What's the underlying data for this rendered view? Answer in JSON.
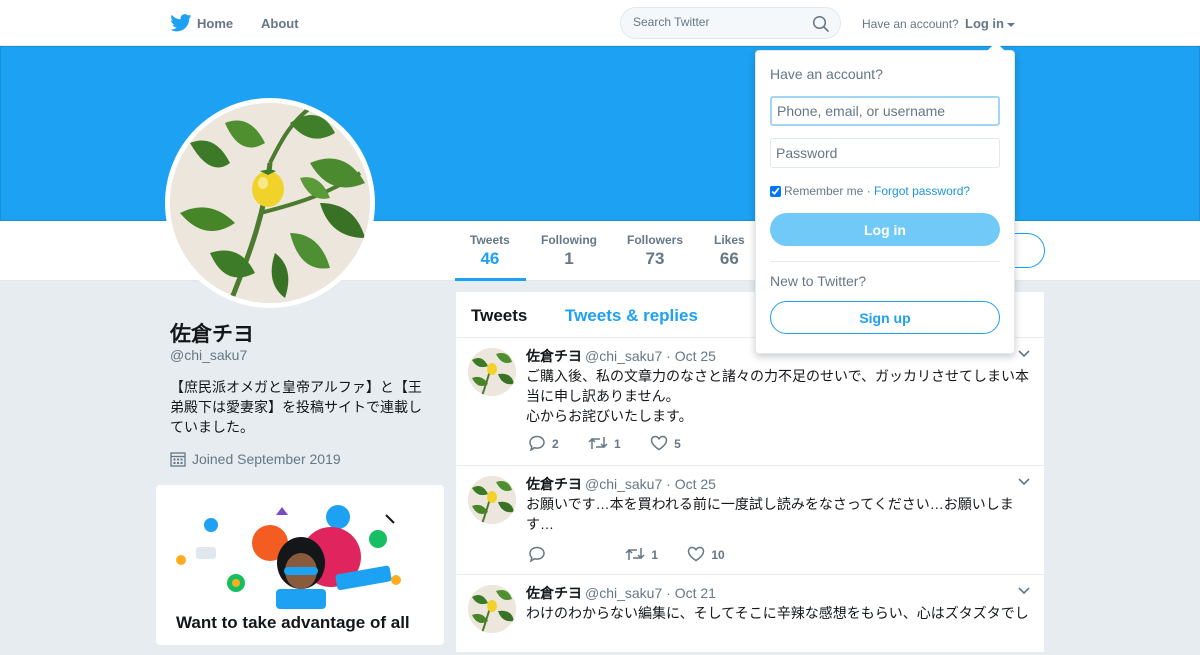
{
  "topbar": {
    "home_label": "Home",
    "about_label": "About",
    "search_placeholder": "Search Twitter",
    "have_account": "Have an account?",
    "login_label": "Log in"
  },
  "profile": {
    "name": "佐倉チヨ",
    "handle": "@chi_saku7",
    "bio": "【庶民派オメガと皇帝アルファ】と【王弟殿下は愛妻家】を投稿サイトで連載していました。",
    "joined": "Joined September 2019"
  },
  "stats": [
    {
      "label": "Tweets",
      "value": "46",
      "active": true
    },
    {
      "label": "Following",
      "value": "1"
    },
    {
      "label": "Followers",
      "value": "73"
    },
    {
      "label": "Likes",
      "value": "66"
    }
  ],
  "timeline": {
    "tabs": [
      "Tweets",
      "Tweets & replies"
    ],
    "tweets": [
      {
        "name": "佐倉チヨ",
        "meta": "@chi_saku7 · Oct 25",
        "text": "ご購入後、私の文章力のなさと諸々の力不足のせいで、ガッカリさせてしまい本当に申し訳ありません。\n心からお詫びいたします。",
        "replies": "2",
        "retweets": "1",
        "likes": "5"
      },
      {
        "name": "佐倉チヨ",
        "meta": "@chi_saku7 · Oct 25",
        "text": "お願いです…本を買われる前に一度試し読みをなさってください…お願いします…",
        "replies": "",
        "retweets": "1",
        "likes": "10"
      },
      {
        "name": "佐倉チヨ",
        "meta": "@chi_saku7 · Oct 21",
        "text": "わけのわからない編集に、そしてそこに辛辣な感想をもらい、心はズタズタでし",
        "replies": "",
        "retweets": "",
        "likes": ""
      }
    ]
  },
  "promo": {
    "title": "Want to take advantage of all"
  },
  "login_dropdown": {
    "title": "Have an account?",
    "username_placeholder": "Phone, email, or username",
    "password_placeholder": "Password",
    "remember_label": "Remember me",
    "separator": "·",
    "forgot_label": "Forgot password?",
    "login_button": "Log in",
    "new_label": "New to Twitter?",
    "signup_button": "Sign up"
  },
  "colors": {
    "brand": "#1da1f2",
    "banner": "#1da1f2",
    "login_button": "#71c9f8",
    "muted_text": "#657786"
  }
}
